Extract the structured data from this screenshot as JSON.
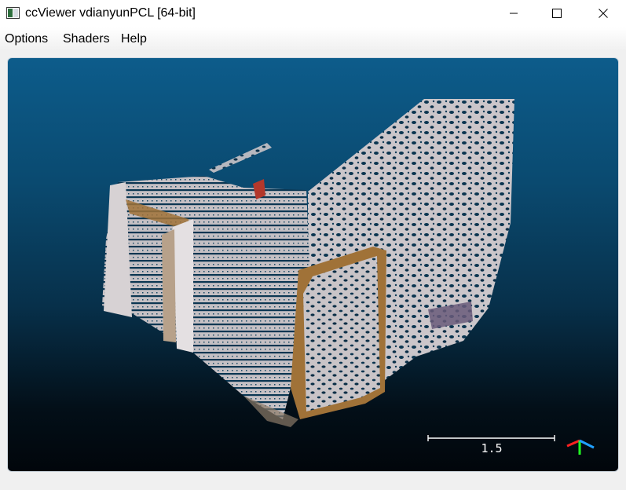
{
  "window": {
    "title": "ccViewer vdianyunPCL [64-bit]",
    "icon": "app-window-icon",
    "controls": [
      "minimize-icon",
      "maximize-icon",
      "close-icon"
    ]
  },
  "menu": {
    "items": [
      {
        "label": "Options"
      },
      {
        "label": "Shaders"
      },
      {
        "label": "Help"
      }
    ]
  },
  "viewport": {
    "scale_label": "1.5",
    "axis_colors": {
      "x": "#ff2020",
      "y": "#20ff20",
      "z": "#20a0ff"
    },
    "background_top": "#0d5c8b",
    "background_bottom": "#01060b",
    "point_cloud_color": "#c8c3c6",
    "accent_brown": "#a07238"
  }
}
